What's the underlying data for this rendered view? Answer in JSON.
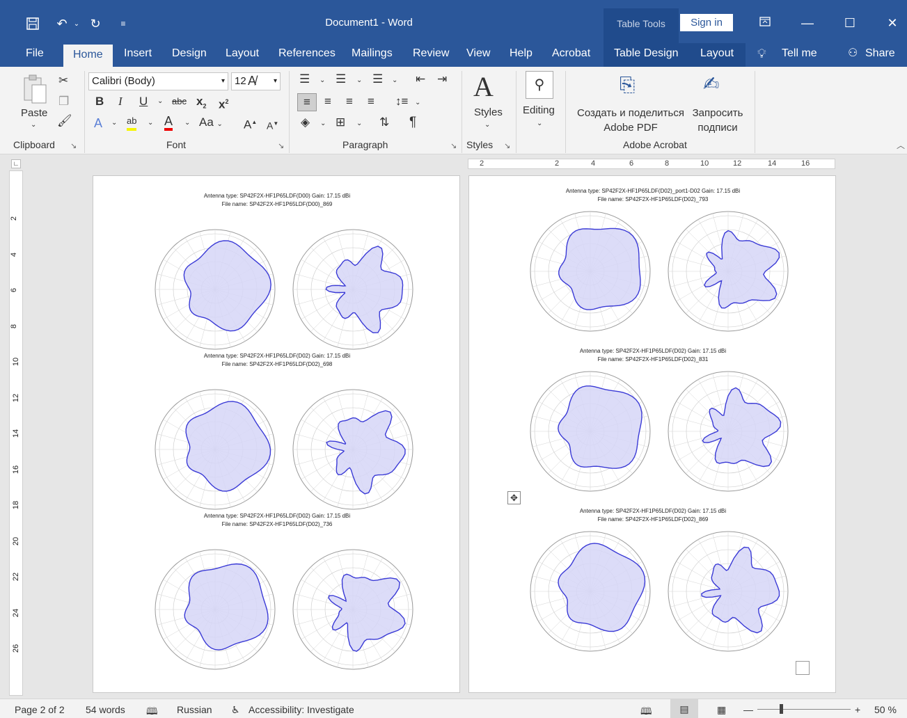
{
  "window": {
    "title": "Document1 - Word",
    "context_group": "Table Tools",
    "signin_label": "Sign in"
  },
  "tabs": [
    "File",
    "Home",
    "Insert",
    "Design",
    "Layout",
    "References",
    "Mailings",
    "Review",
    "View",
    "Help",
    "Acrobat",
    "Table Design",
    "Layout"
  ],
  "tabs_right": {
    "tellme": "Tell me",
    "share": "Share"
  },
  "ribbon": {
    "clipboard": {
      "paste": "Paste",
      "label": "Clipboard"
    },
    "font": {
      "name": "Calibri (Body)",
      "size": "12",
      "label": "Font",
      "change_case": "Aa"
    },
    "paragraph": {
      "label": "Paragraph"
    },
    "styles": {
      "button": "Styles",
      "label": "Styles"
    },
    "editing": {
      "button": "Editing"
    },
    "acrobat": {
      "create_line1": "Создать и поделиться",
      "create_line2": "Adobe PDF",
      "request_line1": "Запросить",
      "request_line2": "подписи",
      "label": "Adobe Acrobat"
    }
  },
  "ruler": {
    "horizontal_labels": [
      "2",
      "2",
      "4",
      "6",
      "8",
      "10",
      "12",
      "14",
      "16"
    ],
    "vertical_labels": [
      "2",
      "4",
      "6",
      "8",
      "10",
      "12",
      "14",
      "16",
      "18",
      "20",
      "22",
      "24",
      "26"
    ]
  },
  "page1": {
    "blocks": [
      {
        "line1": "Antenna type: SP42F2X-HF1P65LDF(D00)   Gain: 17.15 dBi",
        "line2": "File name: SP42F2X-HF1P65LDF(D00)_869"
      },
      {
        "line1": "Antenna type: SP42F2X-HF1P65LDF(D02)   Gain: 17.15 dBi",
        "line2": "File name: SP42F2X-HF1P65LDF(D02)_698"
      },
      {
        "line1": "Antenna type: SP42F2X-HF1P65LDF(D02)   Gain: 17.15 dBi",
        "line2": "File name: SP42F2X-HF1P65LDF(D02)_736"
      }
    ]
  },
  "page2": {
    "blocks": [
      {
        "line1": "Antenna type: SP42F2X-HF1P65LDF(D02)_port1-D02   Gain: 17.15 dBi",
        "line2": "File name: SP42F2X-HF1P65LDF(D02)_793"
      },
      {
        "line1": "Antenna type: SP42F2X-HF1P65LDF(D02)   Gain: 17.15 dBi",
        "line2": "File name: SP42F2X-HF1P65LDF(D02)_831"
      },
      {
        "line1": "Antenna type: SP42F2X-HF1P65LDF(D02)   Gain: 17.15 dBi",
        "line2": "File name: SP42F2X-HF1P65LDF(D02)_869"
      }
    ]
  },
  "statusbar": {
    "page": "Page 2 of 2",
    "words": "54 words",
    "language": "Russian",
    "accessibility": "Accessibility: Investigate",
    "zoom": "50 %"
  },
  "colors": {
    "accent": "#2b579a",
    "pattern_fill": "#d6d6f7",
    "pattern_stroke": "#3a3ad6"
  }
}
